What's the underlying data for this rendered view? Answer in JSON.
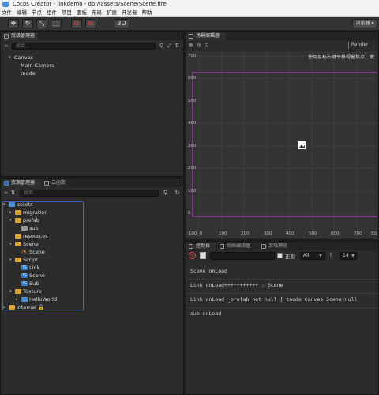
{
  "window": {
    "title": "Cocos Creator - linkdemo - db://assets/Scene/Scene.fire"
  },
  "menu": [
    "文件",
    "编辑",
    "节点",
    "组件",
    "项目",
    "面板",
    "布局",
    "扩展",
    "开发者",
    "帮助"
  ],
  "toolbar": {
    "buttons": [
      "✥",
      "↻",
      "⤡",
      "⬚",
      "⊡"
    ],
    "mode_3d": "3D",
    "preview_label": "浏览器 ▾"
  },
  "hierarchy": {
    "tab": "层级管理器",
    "search_placeholder": "搜索...",
    "nodes": [
      {
        "label": "Canvas",
        "arrow": "▾"
      },
      {
        "label": "Main Camera"
      },
      {
        "label": "tnode"
      }
    ]
  },
  "assets": {
    "tab": "资源管理器",
    "tab2": "云函数",
    "search_placeholder": "搜索...",
    "items": [
      {
        "label": "assets",
        "arrow": "▾",
        "kind": "folder-blue"
      },
      {
        "label": "migration",
        "arrow": "▸",
        "kind": "folder"
      },
      {
        "label": "prefab",
        "arrow": "▾",
        "kind": "folder"
      },
      {
        "label": "sub",
        "kind": "prefab"
      },
      {
        "label": "resources",
        "kind": "folder"
      },
      {
        "label": "Scene",
        "arrow": "▾",
        "kind": "folder"
      },
      {
        "label": "Scene",
        "kind": "scene"
      },
      {
        "label": "Script",
        "arrow": "▾",
        "kind": "folder"
      },
      {
        "label": "Link",
        "kind": "ts",
        "badge": "TS"
      },
      {
        "label": "Scene",
        "kind": "ts",
        "badge": "TS"
      },
      {
        "label": "Sub",
        "kind": "ts",
        "badge": "TS"
      },
      {
        "label": "Texture",
        "arrow": "▾",
        "kind": "folder"
      },
      {
        "label": "HelloWorld",
        "arrow": "▸",
        "kind": "image"
      },
      {
        "label": "internal 🔒",
        "arrow": "▸",
        "kind": "folder"
      }
    ]
  },
  "scene": {
    "tab": "场景编辑器",
    "render_label": "Render",
    "hint": "使用鼠标右键平移视窗焦点，使",
    "y_labels": [
      "700",
      "600",
      "500",
      "400",
      "300",
      "200",
      "100",
      "0"
    ],
    "x_labels": [
      "-100",
      "0",
      "100",
      "200",
      "300",
      "400",
      "500",
      "600",
      "700",
      "800"
    ]
  },
  "console": {
    "tabs": [
      "控制台",
      "动画编辑器",
      "游戏预览"
    ],
    "regex_label": "正则",
    "filter_value": "All",
    "font_size": "14",
    "lines": [
      "Scene onLoad",
      "Link onLoad+++++++++++ : Scene",
      "Link onLoad _prefab not null [ tnode Canvas Scene]null",
      "sub onLoad"
    ]
  }
}
